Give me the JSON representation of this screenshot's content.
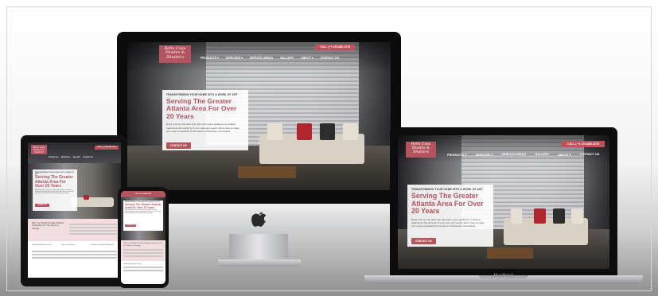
{
  "site": {
    "logo": "Bella Casa Shades & Shutters",
    "call_label": "CALL | +1 678-880-2278",
    "nav": [
      "PRODUCTS ▾",
      "SERVICES ▾",
      "SERVICE AREAS",
      "GALLERY",
      "ABOUT ▾",
      "CONTACT US"
    ],
    "eyebrow": "TRANSFORMING YOUR HOME INTO A WORK OF ART",
    "headline": "Serving The Greater Atlanta Area For Over 20 Years",
    "headline_mobile": "Serving The Greater Atlanta Area For Over 20 Years",
    "body": "Enjoy a home that feels just right with expert guidance on window treatments that perfectly fit your style and needs. We're here to make your space beautifully functional and effortlessly comfortable.",
    "cta": "CONTACT US",
    "section_title": "Why You Should Consider Window Treatments For Your Home in Georgia",
    "feature_labels": [
      "Quality And Style Crafted",
      "Tailored Solutions",
      "Locally Owned And Operated"
    ]
  },
  "devices": {
    "laptop_label": "MacBook"
  },
  "colors": {
    "brand": "#b4545f",
    "accent_pink": "#c0505c"
  }
}
